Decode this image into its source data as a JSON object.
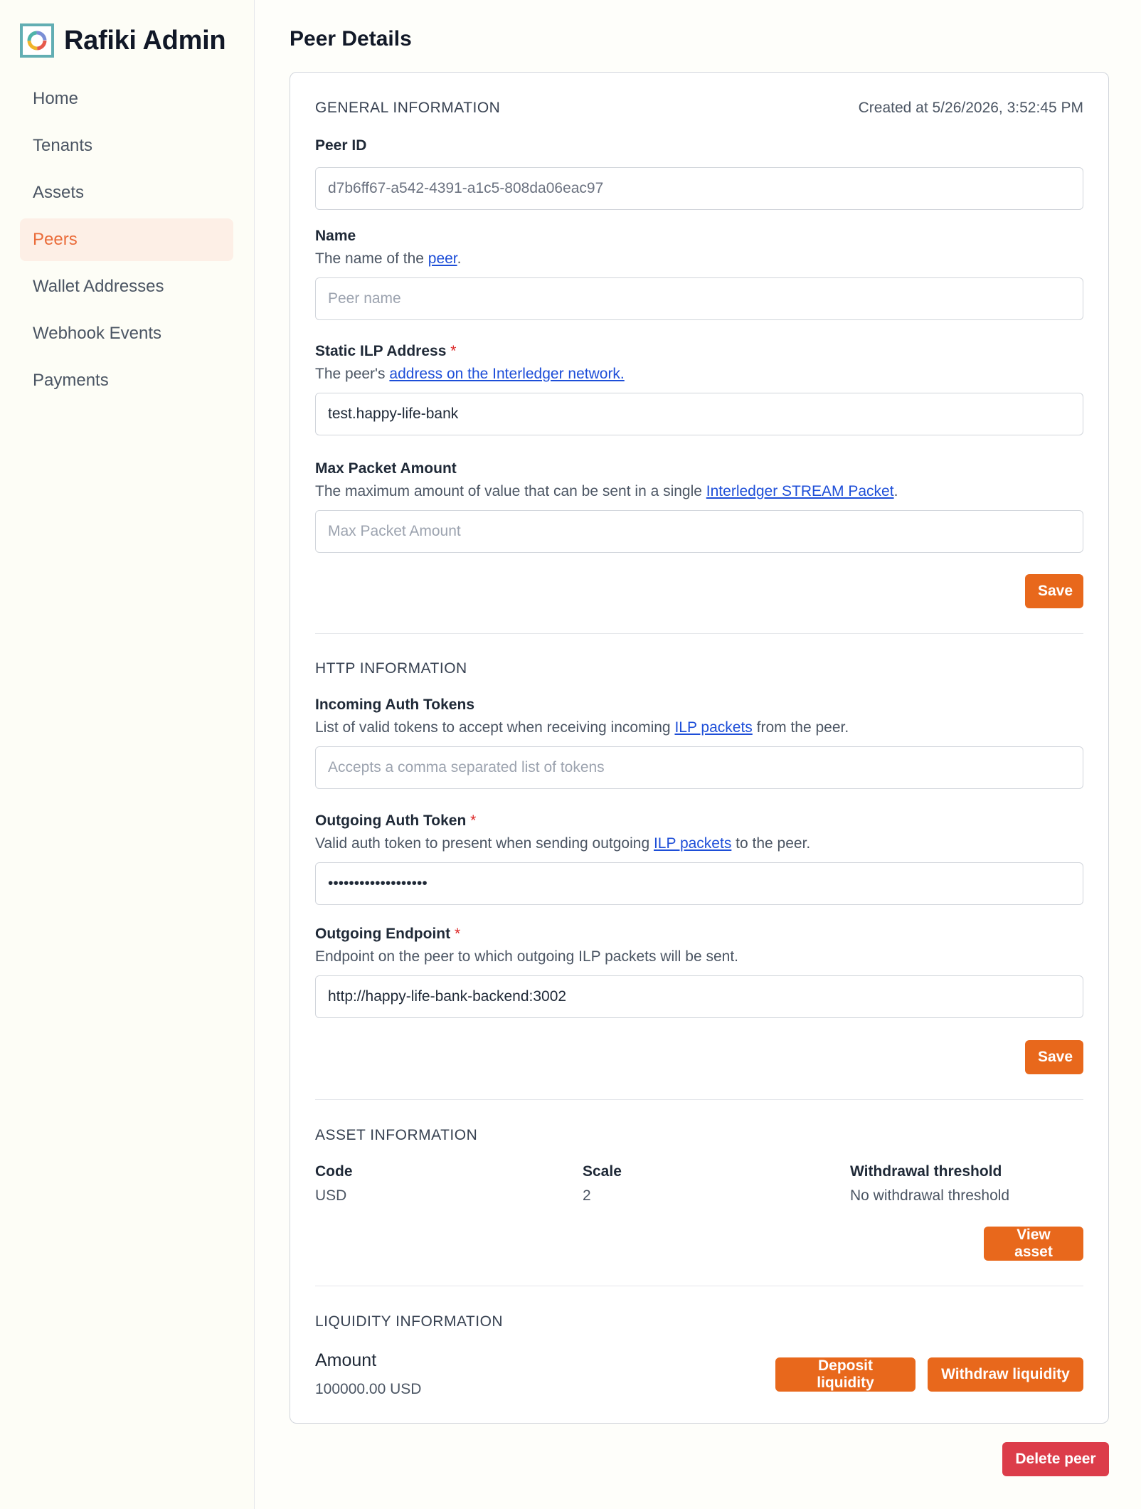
{
  "app": {
    "title": "Rafiki Admin"
  },
  "nav": {
    "items": [
      {
        "label": "Home"
      },
      {
        "label": "Tenants"
      },
      {
        "label": "Assets"
      },
      {
        "label": "Peers"
      },
      {
        "label": "Wallet Addresses"
      },
      {
        "label": "Webhook Events"
      },
      {
        "label": "Payments"
      }
    ],
    "active": "Peers"
  },
  "page": {
    "title": "Peer Details"
  },
  "general": {
    "title": "GENERAL INFORMATION",
    "created": "Created at 5/26/2026, 3:52:45 PM",
    "peer_id": {
      "label": "Peer ID",
      "value": "d7b6ff67-a542-4391-a1c5-808da06eac97"
    },
    "name": {
      "label": "Name",
      "help_prefix": "The name of the ",
      "help_link": "peer",
      "help_suffix": ".",
      "placeholder": "Peer name",
      "value": ""
    },
    "static_ilp": {
      "label": "Static ILP Address",
      "required": "*",
      "help_prefix": "The peer's ",
      "help_link": "address on the Interledger network.",
      "value": "test.happy-life-bank"
    },
    "max_packet": {
      "label": "Max Packet Amount",
      "help_prefix": "The maximum amount of value that can be sent in a single ",
      "help_link": "Interledger STREAM Packet",
      "help_suffix": ".",
      "placeholder": "Max Packet Amount",
      "value": ""
    },
    "save_label": "Save"
  },
  "http": {
    "title": "HTTP INFORMATION",
    "incoming": {
      "label": "Incoming Auth Tokens",
      "help_prefix": "List of valid tokens to accept when receiving incoming ",
      "help_link": "ILP packets",
      "help_suffix": " from the peer.",
      "placeholder": "Accepts a comma separated list of tokens",
      "value": ""
    },
    "outgoing_token": {
      "label": "Outgoing Auth Token",
      "required": "*",
      "help_prefix": "Valid auth token to present when sending outgoing ",
      "help_link": "ILP packets",
      "help_suffix": " to the peer.",
      "value": "•••••••••••••••••••"
    },
    "outgoing_endpoint": {
      "label": "Outgoing Endpoint",
      "required": "*",
      "help": "Endpoint on the peer to which outgoing ILP packets will be sent.",
      "value": "http://happy-life-bank-backend:3002"
    },
    "save_label": "Save"
  },
  "asset": {
    "title": "ASSET INFORMATION",
    "code_label": "Code",
    "code_value": "USD",
    "scale_label": "Scale",
    "scale_value": "2",
    "withdrawal_label": "Withdrawal threshold",
    "withdrawal_value": "No withdrawal threshold",
    "view_label": "View asset"
  },
  "liquidity": {
    "title": "LIQUIDITY INFORMATION",
    "amount_label": "Amount",
    "amount_value": "100000.00 USD",
    "deposit_label": "Deposit liquidity",
    "withdraw_label": "Withdraw liquidity"
  },
  "delete_label": "Delete peer"
}
